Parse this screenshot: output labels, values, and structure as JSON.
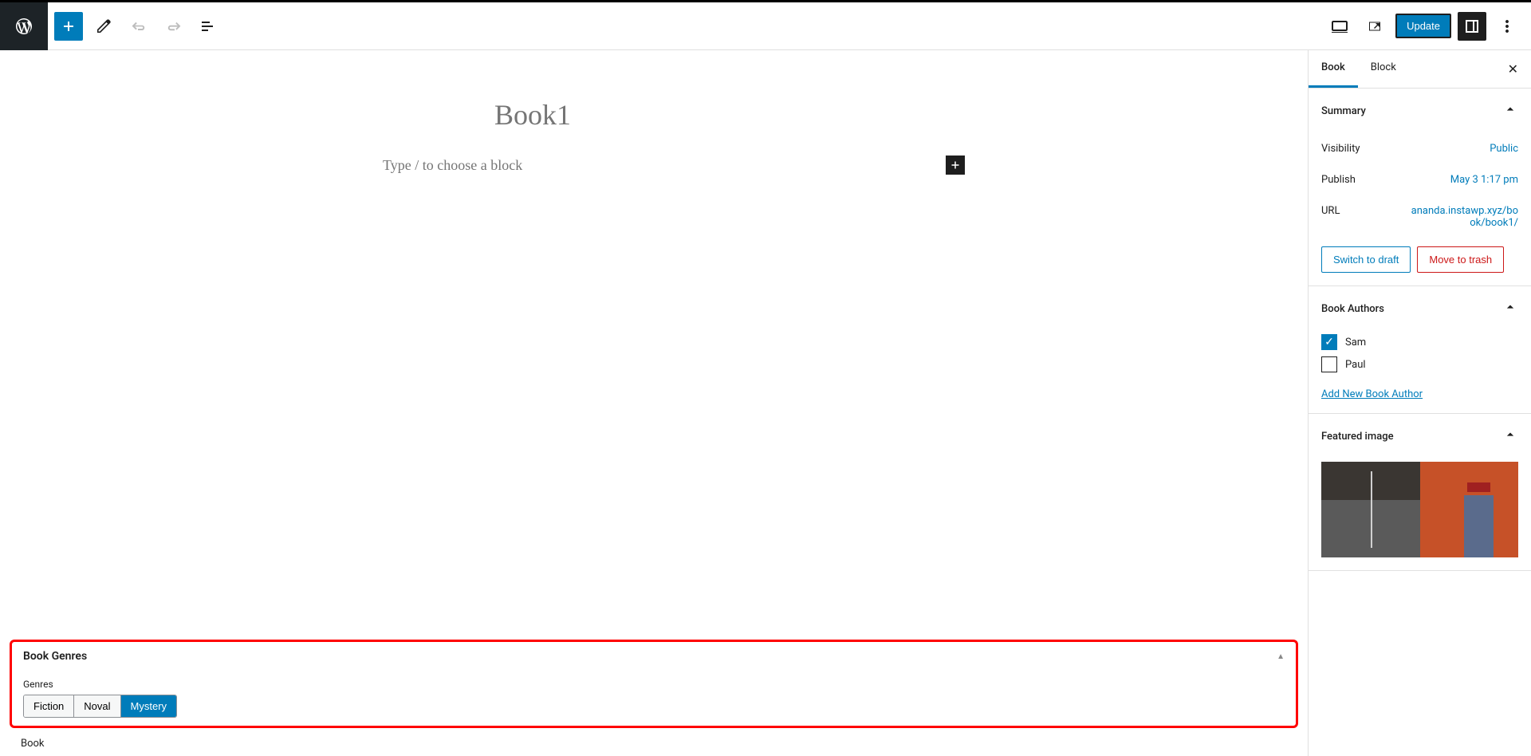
{
  "toolbar": {
    "update_label": "Update"
  },
  "editor": {
    "title": "Book1",
    "block_placeholder": "Type / to choose a block"
  },
  "sidebar": {
    "tabs": {
      "book": "Book",
      "block": "Block"
    },
    "summary": {
      "title": "Summary",
      "visibility": {
        "label": "Visibility",
        "value": "Public"
      },
      "publish": {
        "label": "Publish",
        "value": "May 3 1:17 pm"
      },
      "url": {
        "label": "URL",
        "value": "ananda.instawp.xyz/book/book1/"
      },
      "switch_draft": "Switch to draft",
      "move_trash": "Move to trash"
    },
    "authors": {
      "title": "Book Authors",
      "items": [
        {
          "name": "Sam",
          "checked": true
        },
        {
          "name": "Paul",
          "checked": false
        }
      ],
      "add_link": "Add New Book Author"
    },
    "featured_image": {
      "title": "Featured image"
    }
  },
  "meta": {
    "genres": {
      "title": "Book Genres",
      "label": "Genres",
      "options": [
        {
          "name": "Fiction",
          "active": false
        },
        {
          "name": "Noval",
          "active": false
        },
        {
          "name": "Mystery",
          "active": true
        }
      ]
    }
  },
  "footer": {
    "breadcrumb": "Book"
  }
}
